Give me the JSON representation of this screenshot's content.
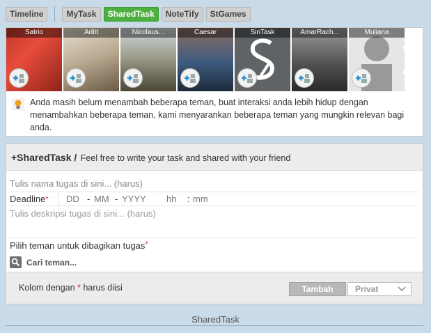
{
  "nav": {
    "tabs": [
      "Timeline",
      "MyTask",
      "SharedTask",
      "NoteTify",
      "StGames"
    ],
    "active": "SharedTask"
  },
  "suggestions": {
    "friends": [
      "Satrio",
      "Aditt",
      "Nicolaus...",
      "Caesar",
      "SinTask",
      "AmarRach...",
      "Muliana"
    ],
    "add_icon": "add-friend-icon",
    "next_icon": "chevron-right-icon",
    "notice": "Anda masih belum menambah beberapa teman, buat interaksi anda lebih hidup dengan menambahkan beberapa teman, kami menyarankan beberapa teman yang mungkin relevan bagi anda."
  },
  "form": {
    "title": "+SharedTask /",
    "subtitle": "Feel free to write your task and shared with your friend",
    "task_placeholder": "Tulis nama tugas di sini... (harus)",
    "deadline_label": "Deadline",
    "required_mark": "*",
    "dd": "DD",
    "mm": "MM",
    "yyyy": "YYYY",
    "hh": "hh",
    "min": "mm",
    "date_sep1": "-",
    "date_sep2": "-",
    "time_sep": ":",
    "desc_placeholder": "Tulis deskripsi tugas di sini... (harus)",
    "share_label": "Pilih teman untuk dibagikan tugas",
    "search_placeholder": "Cari teman...",
    "footer_note_prefix": "Kolom dengan",
    "footer_note_suffix": "harus diisi",
    "add_button": "Tambah",
    "privacy_value": "Privat"
  },
  "bottom_tab": "SharedTask",
  "colors": {
    "accent": "#4caf3e",
    "background": "#c9dbe9",
    "required": "#d9302e"
  }
}
